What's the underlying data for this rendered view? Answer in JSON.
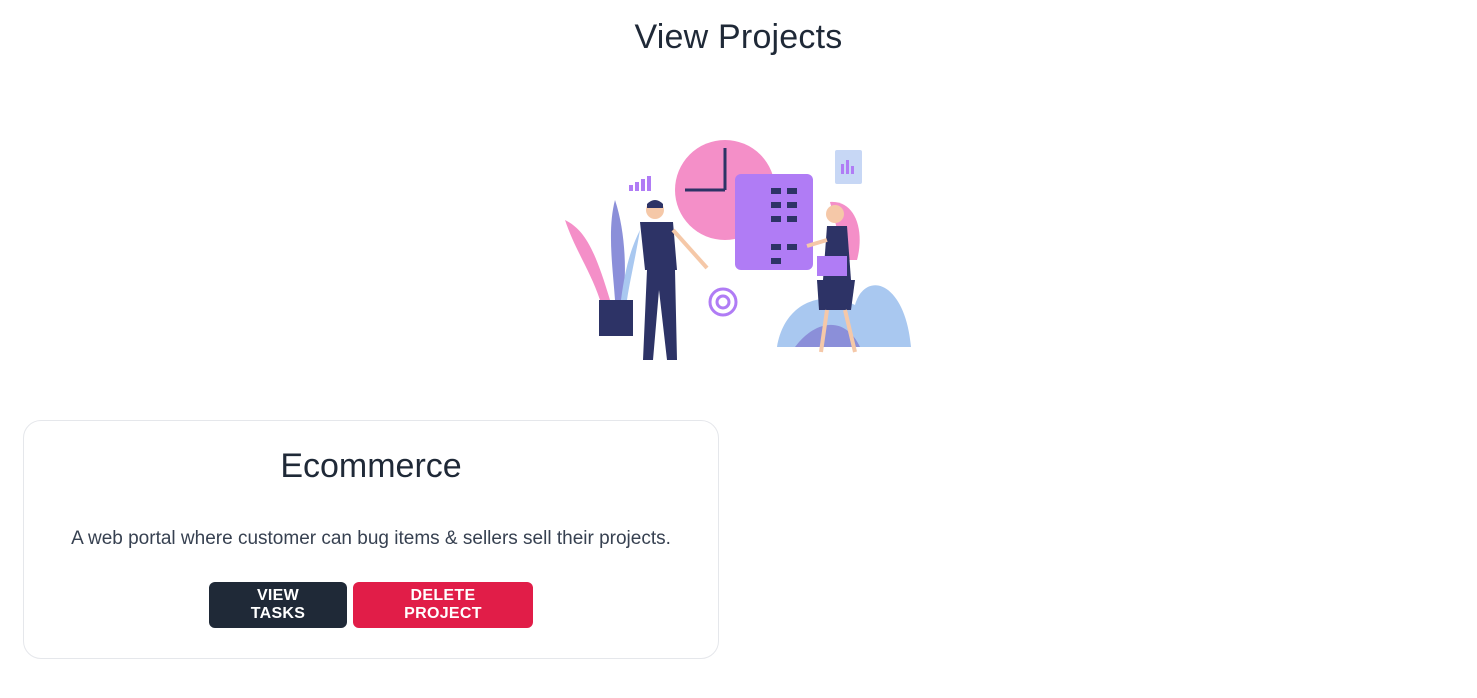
{
  "page": {
    "title": "View Projects"
  },
  "hero": {
    "illustration": "team-project-planning-illustration"
  },
  "projects": [
    {
      "name": "Ecommerce",
      "description": "A web portal where customer can bug items & sellers sell their projects.",
      "view_tasks_label": "VIEW TASKS",
      "delete_label": "DELETE PROJECT"
    }
  ],
  "colors": {
    "dark_button": "#1f2937",
    "danger_button": "#e11d48",
    "illustration_pink": "#f48fc8",
    "illustration_purple": "#b07cf5",
    "illustration_navy": "#2d3366"
  }
}
